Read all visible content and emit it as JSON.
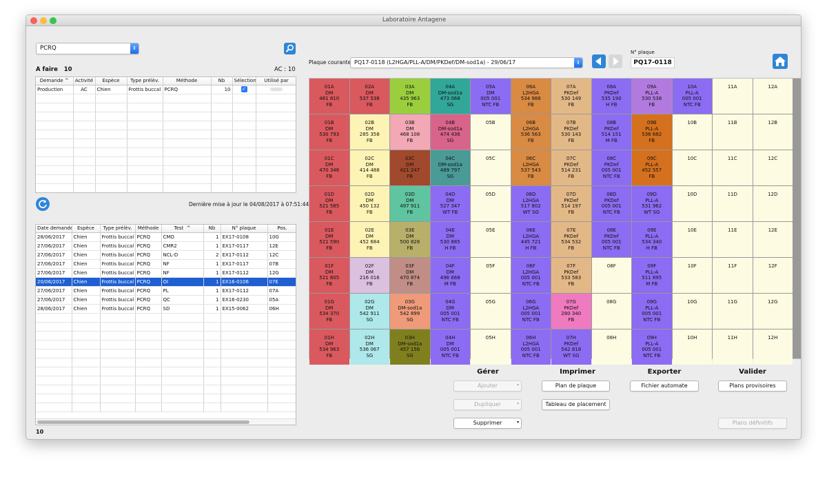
{
  "window": {
    "title": "Laboratoire Antagene"
  },
  "top": {
    "activity_select": "PCRQ",
    "a_faire_label": "A faire",
    "a_faire_count": "10",
    "ac_label": "AC : 10"
  },
  "table1": {
    "headers": [
      "Demande",
      "Activité",
      "Espèce",
      "Type prélèv.",
      "Méthode",
      "Nb",
      "Sélection",
      "Utilisé par"
    ],
    "rows": [
      [
        "Production",
        "AC",
        "Chien",
        "Frottis buccal",
        "PCRQ",
        "10",
        "✓",
        ""
      ]
    ]
  },
  "status": {
    "last_update": "Dernière mise à jour le 04/08/2017 à 07:51:44"
  },
  "table2": {
    "headers": [
      "Date demande",
      "Espèce",
      "Type prélèv.",
      "Méthode",
      "Test",
      "Nb",
      "N° plaque",
      "Pos."
    ],
    "rows": [
      [
        "28/06/2017",
        "Chien",
        "Frottis buccal",
        "PCRQ",
        "CMO",
        "1",
        "EX17-0108",
        "10G"
      ],
      [
        "27/06/2017",
        "Chien",
        "Frottis buccal",
        "PCRQ",
        "CMR2",
        "1",
        "EX17-0117",
        "12E"
      ],
      [
        "27/06/2017",
        "Chien",
        "Frottis buccal",
        "PCRQ",
        "NCL-D",
        "2",
        "EX17-0112",
        "12C"
      ],
      [
        "27/06/2017",
        "Chien",
        "Frottis buccal",
        "PCRQ",
        "NF",
        "1",
        "EX17-0117",
        "07B"
      ],
      [
        "27/06/2017",
        "Chien",
        "Frottis buccal",
        "PCRQ",
        "NF",
        "1",
        "EX17-0112",
        "12G"
      ],
      [
        "20/06/2017",
        "Chien",
        "Frottis buccal",
        "PCRQ",
        "OI",
        "1",
        "EX16-0106",
        "07E"
      ],
      [
        "27/06/2017",
        "Chien",
        "Frottis buccal",
        "PCRQ",
        "PL",
        "1",
        "EX17-0112",
        "07A"
      ],
      [
        "27/06/2017",
        "Chien",
        "Frottis buccal",
        "PCRQ",
        "QC",
        "1",
        "EX16-0230",
        "05A"
      ],
      [
        "28/06/2017",
        "Chien",
        "Frottis buccal",
        "PCRQ",
        "SD",
        "1",
        "EX15-0062",
        "06H"
      ]
    ],
    "footer_count": "10"
  },
  "plate": {
    "label": "Plaque courante",
    "select": "PQ17-0118 (L2HGA/PLL-A/DM/PKDef/DM-sod1a) - 29/06/17",
    "plate_no_label": "N° plaque",
    "plate_no": "PQ17-0118",
    "rows": [
      [
        {
          "t": "01A\nDM\n461 810\nFB",
          "c": "#d9595e"
        },
        {
          "t": "02A\nDM\n537 538\nFB",
          "c": "#d9595e"
        },
        {
          "t": "03A\nDM\n435 963\nFB",
          "c": "#9bce3d"
        },
        {
          "t": "04A\nDM-sod1a\n473 068\nSG",
          "c": "#31a79a"
        },
        {
          "t": "05A\nDM\n005 001\nNTC FB",
          "c": "#8b6cf2"
        },
        {
          "t": "06A\nL2HGA\n534 988\nFB",
          "c": "#d98a43"
        },
        {
          "t": "07A\nPKDef\n530 149\nFB",
          "c": "#e3b887"
        },
        {
          "t": "08A\nPKDef\n535 190\nH FB",
          "c": "#8b6cf2"
        },
        {
          "t": "09A\nPLL-A\n530 538\nFB",
          "c": "#b27ade"
        },
        {
          "t": "10A\nPLL-A\n005 001\nNTC FB",
          "c": "#8b6cf2"
        },
        {
          "t": "11A",
          "c": "#fdfbe2"
        },
        {
          "t": "12A",
          "c": "#fdfbe2"
        }
      ],
      [
        {
          "t": "01B\nDM\n530 793\nFB",
          "c": "#d9595e"
        },
        {
          "t": "02B\nDM\n285 358\nFB",
          "c": "#fdf3b4"
        },
        {
          "t": "03B\nDM\n468 108\nFB",
          "c": "#f2a8b5"
        },
        {
          "t": "04B\nDM-sod1a\n474 436\nSG",
          "c": "#d9648b"
        },
        {
          "t": "05B",
          "c": "#fdfbe2"
        },
        {
          "t": "06B\nL2HGA\n536 563\nFB",
          "c": "#d98a43"
        },
        {
          "t": "07B\nPKDef\n530 143\nFB",
          "c": "#e3b887"
        },
        {
          "t": "08B\nPKDef\n514 151\nM FB",
          "c": "#8b6cf2"
        },
        {
          "t": "09B\nPLL-A\n536 682\nFB",
          "c": "#d4701e"
        },
        {
          "t": "10B",
          "c": "#fdfbe2"
        },
        {
          "t": "11B",
          "c": "#fdfbe2"
        },
        {
          "t": "12B",
          "c": "#fdfbe2"
        }
      ],
      [
        {
          "t": "01C\nDM\n470 346\nFB",
          "c": "#d9595e"
        },
        {
          "t": "02C\nDM\n414 488\nFB",
          "c": "#fdf3b4"
        },
        {
          "t": "03C\nDM\n421 247\nFB",
          "c": "#a0492c"
        },
        {
          "t": "04C\nDM-sod1a\n489 797\nSG",
          "c": "#4a9a98"
        },
        {
          "t": "05C",
          "c": "#fdfbe2"
        },
        {
          "t": "06C\nL2HGA\n537 543\nFB",
          "c": "#d98a43"
        },
        {
          "t": "07C\nPKDef\n514 231\nFB",
          "c": "#e3b887"
        },
        {
          "t": "08C\nPKDef\n005 001\nNTC FB",
          "c": "#8b6cf2"
        },
        {
          "t": "09C\nPLL-A\n452 557\nFB",
          "c": "#d4701e"
        },
        {
          "t": "10C",
          "c": "#fdfbe2"
        },
        {
          "t": "11C",
          "c": "#fdfbe2"
        },
        {
          "t": "12C",
          "c": "#fdfbe2"
        }
      ],
      [
        {
          "t": "01D\nDM\n521 585\nFB",
          "c": "#d9595e"
        },
        {
          "t": "02D\nDM\n450 132\nFB",
          "c": "#fdf3b4"
        },
        {
          "t": "03D\nDM\n497 911\nFB",
          "c": "#5fc4a0"
        },
        {
          "t": "04D\nDM\n527 347\nWT FB",
          "c": "#8b6cf2"
        },
        {
          "t": "05D",
          "c": "#fdfbe2"
        },
        {
          "t": "06D\nL2HGA\n517 802\nWT SG",
          "c": "#8b6cf2"
        },
        {
          "t": "07D\nPKDef\n514 197\nFB",
          "c": "#e3b887"
        },
        {
          "t": "08D\nPKDef\n005 001\nNTC FB",
          "c": "#8b6cf2"
        },
        {
          "t": "09D\nPLL-A\n531 962\nWT SG",
          "c": "#8b6cf2"
        },
        {
          "t": "10D",
          "c": "#fdfbe2"
        },
        {
          "t": "11D",
          "c": "#fdfbe2"
        },
        {
          "t": "12D",
          "c": "#fdfbe2"
        }
      ],
      [
        {
          "t": "01E\nDM\n521 590\nFB",
          "c": "#d9595e"
        },
        {
          "t": "02E\nDM\n452 684\nFB",
          "c": "#fdf3b4"
        },
        {
          "t": "03E\nDM\n500 828\nFB",
          "c": "#b8b06a"
        },
        {
          "t": "04E\nDM\n530 885\nH FB",
          "c": "#8b6cf2"
        },
        {
          "t": "05E",
          "c": "#fdfbe2"
        },
        {
          "t": "06E\nL2HGA\n445 721\nH FB",
          "c": "#8b6cf2"
        },
        {
          "t": "07E\nPKDef\n534 532\nFB",
          "c": "#e3b887"
        },
        {
          "t": "08E\nPKDef\n005 001\nNTC FB",
          "c": "#8b6cf2"
        },
        {
          "t": "09E\nPLL-A\n534 340\nH FB",
          "c": "#8b6cf2"
        },
        {
          "t": "10E",
          "c": "#fdfbe2"
        },
        {
          "t": "11E",
          "c": "#fdfbe2"
        },
        {
          "t": "12E",
          "c": "#fdfbe2"
        }
      ],
      [
        {
          "t": "01F\nDM\n521 605\nFB",
          "c": "#d9595e"
        },
        {
          "t": "02F\nDM\n216 016\nFB",
          "c": "#dcc0e0"
        },
        {
          "t": "03F\nDM\n470 874\nFB",
          "c": "#c08e86"
        },
        {
          "t": "04F\nDM\n496 668\nM FB",
          "c": "#8b6cf2"
        },
        {
          "t": "05F",
          "c": "#fdfbe2"
        },
        {
          "t": "06F\nL2HGA\n005 001\nNTC FB",
          "c": "#8b6cf2"
        },
        {
          "t": "07F\nPKDef\n533 583\nFB",
          "c": "#e3b887"
        },
        {
          "t": "08F",
          "c": "#fdfbe2"
        },
        {
          "t": "09F\nPLL-A\n511 895\nM FB",
          "c": "#8b6cf2"
        },
        {
          "t": "10F",
          "c": "#fdfbe2"
        },
        {
          "t": "11F",
          "c": "#fdfbe2"
        },
        {
          "t": "12F",
          "c": "#fdfbe2"
        }
      ],
      [
        {
          "t": "01G\nDM\n534 370\nFB",
          "c": "#d9595e"
        },
        {
          "t": "02G\nDM\n542 911\nSG",
          "c": "#aee8ea"
        },
        {
          "t": "03G\nDM-sod1a\n542 899\nSG",
          "c": "#ef9b7a"
        },
        {
          "t": "04G\nDM\n005 001\nNTC FB",
          "c": "#8b6cf2"
        },
        {
          "t": "05G",
          "c": "#fdfbe2"
        },
        {
          "t": "06G\nL2HGA\n005 001\nNTC FB",
          "c": "#8b6cf2"
        },
        {
          "t": "07G\nPKDef\n280 340\nFB",
          "c": "#f07ac0"
        },
        {
          "t": "08G",
          "c": "#fdfbe2"
        },
        {
          "t": "09G\nPLL-A\n005 001\nNTC FB",
          "c": "#8b6cf2"
        },
        {
          "t": "10G",
          "c": "#fdfbe2"
        },
        {
          "t": "11G",
          "c": "#fdfbe2"
        },
        {
          "t": "12G",
          "c": "#fdfbe2"
        }
      ],
      [
        {
          "t": "01H\nDM\n534 963\nFB",
          "c": "#d9595e"
        },
        {
          "t": "02H\nDM\n536 067\nSG",
          "c": "#aee8ea"
        },
        {
          "t": "03H\nDM-sod1a\n457 156\nSG",
          "c": "#7f7f1e"
        },
        {
          "t": "04H\nDM\n005 001\nNTC FB",
          "c": "#8b6cf2"
        },
        {
          "t": "05H",
          "c": "#fdfbe2"
        },
        {
          "t": "06H\nL2HGA\n005 001\nNTC FB",
          "c": "#8b6cf2"
        },
        {
          "t": "07H\nPKDef\n542 818\nWT SG",
          "c": "#8b6cf2"
        },
        {
          "t": "08H",
          "c": "#fdfbe2"
        },
        {
          "t": "09H\nPLL-A\n005 001\nNTC FB",
          "c": "#8b6cf2"
        },
        {
          "t": "10H",
          "c": "#fdfbe2"
        },
        {
          "t": "11H",
          "c": "#fdfbe2"
        },
        {
          "t": "12H",
          "c": "#fdfbe2"
        }
      ]
    ]
  },
  "actions": {
    "gerer": "Gérer",
    "imprimer": "Imprimer",
    "exporter": "Exporter",
    "valider": "Valider",
    "ajouter": "Ajouter",
    "dupliquer": "Dupliquer",
    "supprimer": "Supprimer",
    "plan_plaque": "Plan de plaque",
    "tableau_placement": "Tableau de placement",
    "fichier_automate": "Fichier automate",
    "plans_provisoires": "Plans provisoires",
    "plans_definitifs": "Plans définitifs"
  }
}
